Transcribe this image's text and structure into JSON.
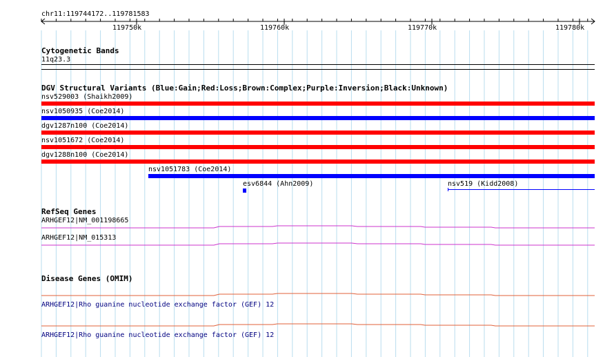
{
  "ruler": {
    "location": "chr11:119744172..119781583",
    "ticks": [
      "119750k",
      "119760k",
      "119770k",
      "119780k"
    ]
  },
  "cytoband": {
    "title": "Cytogenetic Bands",
    "band": "11q23.3"
  },
  "dgv": {
    "title": "DGV Structural Variants (Blue:Gain;Red:Loss;Brown:Complex;Purple:Inversion;Black:Unknown)",
    "variants": [
      {
        "label": "nsv529003 (Shaikh2009)",
        "color": "#ff0000"
      },
      {
        "label": "nsv1050935 (Coe2014)",
        "color": "#0000ff"
      },
      {
        "label": "dgv1287n100 (Coe2014)",
        "color": "#ff0000"
      },
      {
        "label": "nsv1051672 (Coe2014)",
        "color": "#ff0000"
      },
      {
        "label": "dgv1288n100 (Coe2014)",
        "color": "#ff0000"
      },
      {
        "label": "nsv1051783 (Coe2014)",
        "color": "#0000ff"
      },
      {
        "label": "esv6844 (Ahn2009)",
        "color": "#0000ff"
      },
      {
        "label": "nsv519 (Kidd2008)",
        "color": "#0000ff"
      }
    ]
  },
  "refseq": {
    "title": "RefSeq Genes",
    "genes": [
      {
        "label": "ARHGEF12|NM_001198665",
        "color": "#cc33cc"
      },
      {
        "label": "ARHGEF12|NM_015313",
        "color": "#cc33cc"
      }
    ]
  },
  "omim": {
    "title": "Disease Genes (OMIM)",
    "genes": [
      {
        "label": "ARHGEF12|Rho guanine nucleotide exchange factor (GEF) 12",
        "color": "#e0603a"
      },
      {
        "label": "ARHGEF12|Rho guanine nucleotide exchange factor (GEF) 12",
        "color": "#e0603a"
      }
    ]
  },
  "colors": {
    "grid": "#b8ddee",
    "loss": "#ff0000",
    "gain": "#0000ff",
    "refseq": "#cc33cc",
    "omim": "#e0603a",
    "link": "#000080"
  }
}
